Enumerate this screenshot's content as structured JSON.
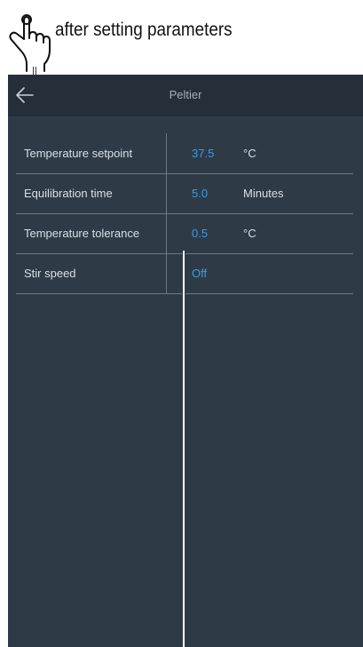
{
  "annotation": {
    "caption": "after setting parameters",
    "icon": "hand-pointer-icon"
  },
  "header": {
    "title": "Peltier",
    "back_icon": "arrow-left-icon"
  },
  "parameters": [
    {
      "label": "Temperature setpoint",
      "value": "37.5",
      "unit": "°C"
    },
    {
      "label": "Equilibration time",
      "value": "5.0",
      "unit": "Minutes"
    },
    {
      "label": "Temperature tolerance",
      "value": "0.5",
      "unit": "°C"
    },
    {
      "label": "Stir speed",
      "value": "Off",
      "unit": ""
    }
  ],
  "colors": {
    "panel": "#2e3b47",
    "header": "#252f3a",
    "value": "#3a9be8",
    "text": "#d9dfe5",
    "divider": "#6c7883"
  }
}
